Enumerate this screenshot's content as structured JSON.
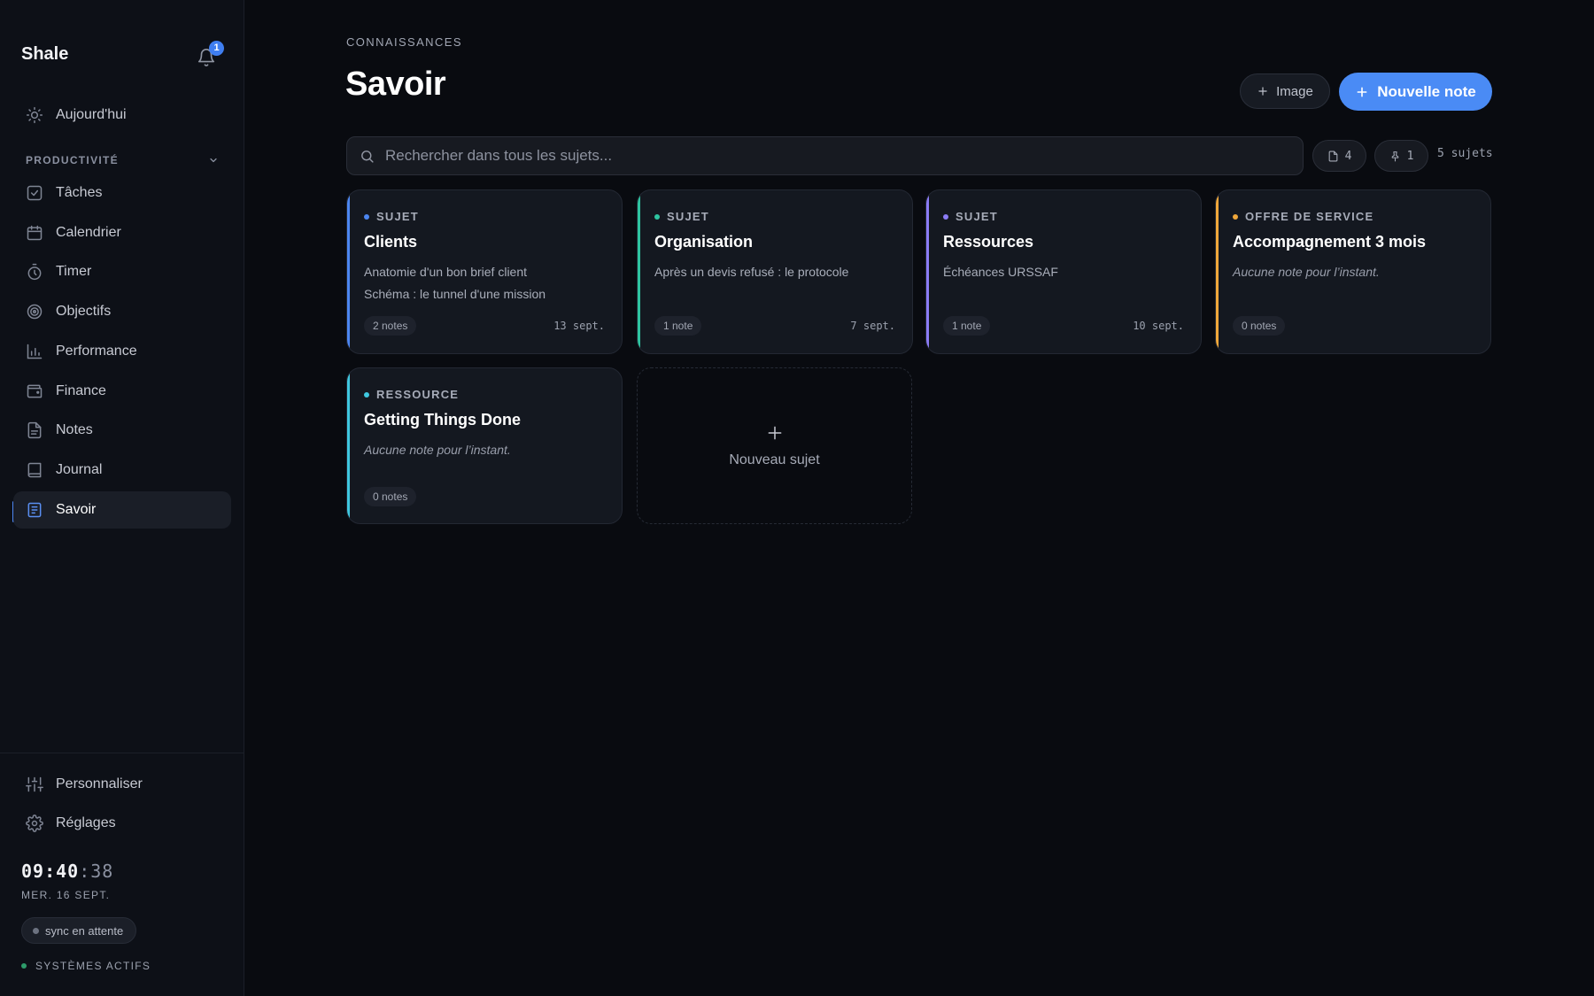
{
  "app": {
    "name": "Shale",
    "notification_count": "1"
  },
  "sidebar": {
    "top_item": {
      "label": "Aujourd'hui",
      "icon": "sun-icon"
    },
    "section": {
      "label": "PRODUCTIVITÉ"
    },
    "items": [
      {
        "label": "Tâches",
        "icon": "checkbox-icon"
      },
      {
        "label": "Calendrier",
        "icon": "calendar-icon"
      },
      {
        "label": "Timer",
        "icon": "stopwatch-icon"
      },
      {
        "label": "Objectifs",
        "icon": "target-icon"
      },
      {
        "label": "Performance",
        "icon": "bar-chart-icon"
      },
      {
        "label": "Finance",
        "icon": "wallet-icon"
      },
      {
        "label": "Notes",
        "icon": "document-icon"
      },
      {
        "label": "Journal",
        "icon": "book-icon"
      },
      {
        "label": "Savoir",
        "icon": "knowledge-book-icon",
        "active": true
      }
    ],
    "bottom_items": [
      {
        "label": "Personnaliser",
        "icon": "sliders-icon"
      },
      {
        "label": "Réglages",
        "icon": "gear-icon"
      }
    ],
    "clock": {
      "hm": "09:40",
      "sec": ":38"
    },
    "date": "MER. 16 SEPT.",
    "sync_status": "sync en attente",
    "systems_status": "SYSTÈMES ACTIFS"
  },
  "header": {
    "eyebrow": "CONNAISSANCES",
    "title": "Savoir",
    "image_button": "Image",
    "new_note_button": "Nouvelle note"
  },
  "search": {
    "placeholder": "Rechercher dans tous les sujets..."
  },
  "stats": {
    "notes_count": "4",
    "pinned_count": "1",
    "subjects_label": "5 sujets"
  },
  "colors": {
    "accent": "#4a8bf5",
    "blue": "#4c86f1",
    "green": "#2ec4a0",
    "violet": "#8b7cf6",
    "amber": "#f0a73a",
    "cyan": "#3fc8e0"
  },
  "cards": [
    {
      "tag": "SUJET",
      "title": "Clients",
      "lines": [
        "Anatomie d'un bon brief client",
        "Schéma : le tunnel d'une mission"
      ],
      "count": "2 notes",
      "date": "13 sept."
    },
    {
      "tag": "SUJET",
      "title": "Organisation",
      "lines": [
        "Après un devis refusé : le protocole"
      ],
      "count": "1 note",
      "date": "7 sept."
    },
    {
      "tag": "SUJET",
      "title": "Ressources",
      "lines": [
        "Échéances URSSAF"
      ],
      "count": "1 note",
      "date": "10 sept."
    },
    {
      "tag": "OFFRE DE SERVICE",
      "title": "Accompagnement 3 mois",
      "empty": "Aucune note pour l’instant.",
      "count": "0 notes"
    },
    {
      "tag": "RESSOURCE",
      "title": "Getting Things Done",
      "empty": "Aucune note pour l’instant.",
      "count": "0 notes"
    }
  ],
  "new_subject": {
    "label": "Nouveau sujet"
  }
}
